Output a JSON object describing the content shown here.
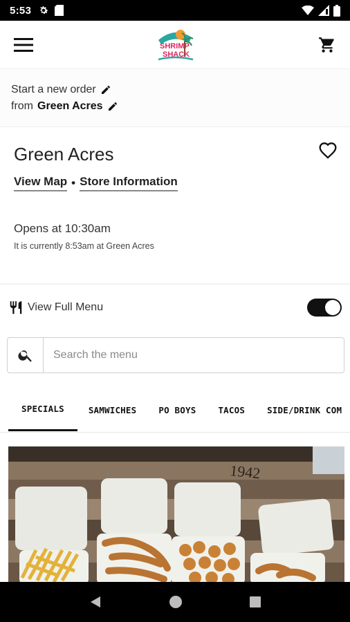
{
  "status_bar": {
    "time": "5:53",
    "icons": [
      "gear-icon",
      "sd-card-icon",
      "wifi-icon",
      "signal-icon",
      "battery-icon"
    ]
  },
  "app_bar": {
    "menu_icon": "hamburger-icon",
    "logo_text_line1": "SHRIMP",
    "logo_text_line2": "SHACK",
    "cart_icon": "cart-icon"
  },
  "order": {
    "line1": "Start a new order",
    "line2_prefix": "from",
    "location": "Green Acres"
  },
  "store": {
    "name": "Green Acres",
    "view_map": "View Map",
    "separator": "•",
    "store_info": "Store Information",
    "opens": "Opens at 10:30am",
    "current": "It is currently 8:53am at Green Acres"
  },
  "full_menu": {
    "label": "View Full Menu",
    "toggle_on": true
  },
  "search": {
    "placeholder": "Search the menu"
  },
  "tabs": [
    {
      "label": "SPECIALS",
      "active": true
    },
    {
      "label": "SAMWICHES",
      "active": false
    },
    {
      "label": "PO BOYS",
      "active": false
    },
    {
      "label": "TACOS",
      "active": false
    },
    {
      "label": "SIDE/DRINK COM",
      "active": false
    }
  ],
  "hero": {
    "image_label": "1942"
  },
  "colors": {
    "logo_teal": "#2aa7a0",
    "logo_red": "#e0245e",
    "logo_orange": "#f29b2e",
    "accent": "#111111"
  }
}
